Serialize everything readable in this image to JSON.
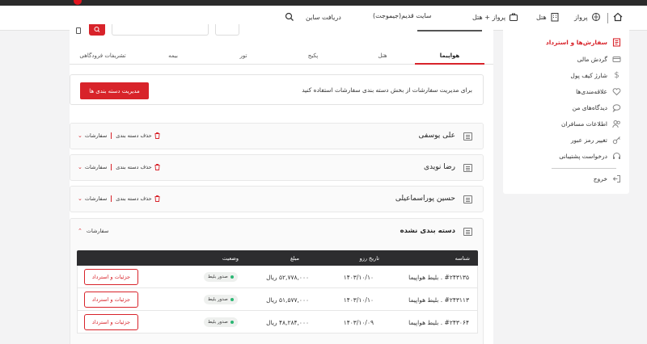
{
  "nav": {
    "home_icon": "home-icon",
    "flight_label": "پرواز",
    "hotel_label": "هتل",
    "flight_hotel_label": "پرواز + هتل",
    "old_site_label": "سایت قدیم(جیموجت)",
    "receive_app_label": "دریافت ساین"
  },
  "sidebar": {
    "items": [
      {
        "label": "سفارش‌ها و استرداد",
        "icon": "receipt-icon"
      },
      {
        "label": "گردش مالی",
        "icon": "card-icon"
      },
      {
        "label": "شارژ کیف پول",
        "icon": "dollar-icon"
      },
      {
        "label": "علاقه‌مندی‌ها",
        "icon": "heart-icon"
      },
      {
        "label": "دیدگاه‌های من",
        "icon": "chat-icon"
      },
      {
        "label": "اطلاعات مسافران",
        "icon": "users-icon"
      },
      {
        "label": "تغییر رمز عبور",
        "icon": "key-icon"
      },
      {
        "label": "درخواست پشتیبانی",
        "icon": "headset-icon"
      }
    ],
    "logout_label": "خروج"
  },
  "tabs": [
    "هواپیما",
    "هتل",
    "پکیج",
    "تور",
    "بیمه",
    "تشریفات فرودگاهی"
  ],
  "info": {
    "text": "برای مدیریت سفارشات از بخش دسته بندی سفارشات استفاده کنید",
    "button": "مدیریت دسته بندی ها"
  },
  "categories": [
    {
      "name": "علی یوسفی",
      "delete_label": "حذف دسته بندی",
      "orders_label": "سفارشات"
    },
    {
      "name": "رضا نویدی",
      "delete_label": "حذف دسته بندی",
      "orders_label": "سفارشات"
    },
    {
      "name": "حسین پوراسماعیلی",
      "delete_label": "حذف دسته بندی",
      "orders_label": "سفارشات"
    }
  ],
  "uncategorized": {
    "name": "دسته بندی نشده",
    "orders_label": "سفارشات",
    "headers": {
      "id": "شناسه",
      "date": "تاریخ رزو",
      "amount": "مبلغ",
      "status": "وضعیت"
    },
    "rows": [
      {
        "id": "#۲۴۳۱۳۵ . بلیط هواپیما",
        "date": "۱۴۰۳/۱۰/۱۰",
        "amount": "۵۲,۷۷۸,۰۰۰ ریال",
        "status": "صدور بلیط",
        "action": "جزئیات و استرداد"
      },
      {
        "id": "#۲۴۳۱۱۳ . بلیط هواپیما",
        "date": "۱۴۰۳/۱۰/۱۰",
        "amount": "۵۱,۵۷۷,۰۰۰ ریال",
        "status": "صدور بلیط",
        "action": "جزئیات و استرداد"
      },
      {
        "id": "#۲۴۳۰۶۴ . بلیط هواپیما",
        "date": "۱۴۰۳/۱۰/۰۹",
        "amount": "۴۸,۲۸۴,۰۰۰ ریال",
        "status": "صدور بلیط",
        "action": "جزئیات و استرداد"
      }
    ]
  },
  "colors": {
    "accent": "#d8232a",
    "dark": "#2d2d2f",
    "success": "#2bb673"
  }
}
